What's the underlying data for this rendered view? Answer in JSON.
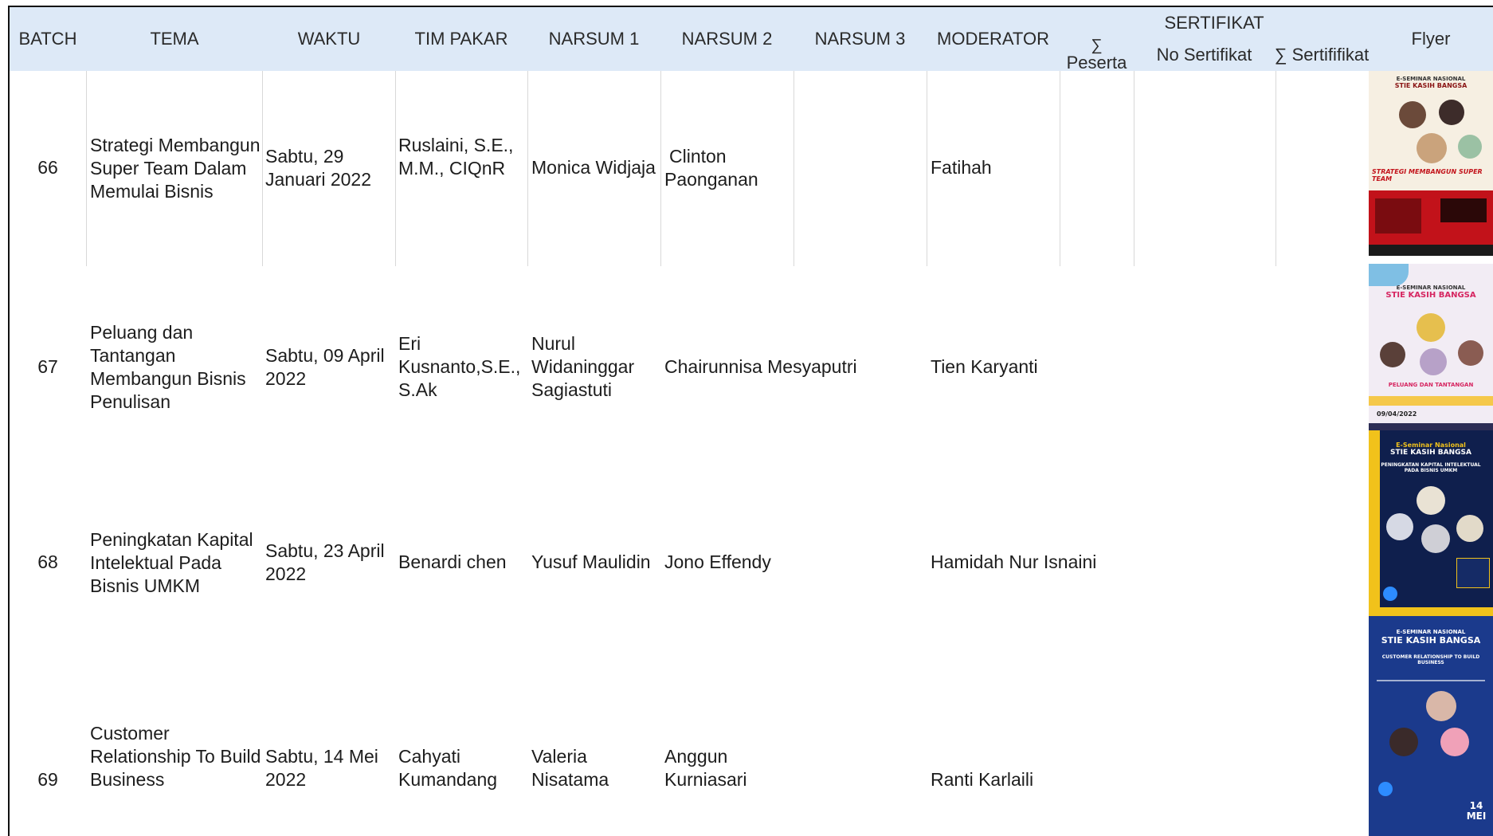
{
  "headers": {
    "batch": "BATCH",
    "tema": "TEMA",
    "waktu": "WAKTU",
    "tim_pakar": "TIM PAKAR",
    "narsum1": "NARSUM 1",
    "narsum2": "NARSUM 2",
    "narsum3": "NARSUM 3",
    "moderator": "MODERATOR",
    "peserta_symbol": "∑",
    "peserta": "Peserta",
    "sertifikat": "SERTIFIKAT",
    "no_sertifikat": "No Sertifikat",
    "sum_sertifikat": "∑ Sertififikat",
    "flyer": "Flyer"
  },
  "rows": [
    {
      "batch": "66",
      "tema": [
        "Strategi Membangun",
        "Super Team Dalam",
        "Memulai Bisnis"
      ],
      "waktu": [
        "Sabtu, 29",
        "Januari 2022"
      ],
      "tim_pakar": [
        "Ruslaini, S.E.,",
        "M.M., CIQnR"
      ],
      "narsum1": [
        "Monica Widjaja"
      ],
      "narsum2": [
        "Clinton",
        "Paonganan"
      ],
      "narsum3": [],
      "moderator": [
        "Fatihah"
      ],
      "flyer": {
        "top": "E-SEMINAR NASIONAL",
        "title": "STIE KASIH BANGSA",
        "tag": "STRATEGI MEMBANGUN SUPER TEAM",
        "bg": "#f6efe2",
        "band": "#c2121a"
      }
    },
    {
      "batch": "67",
      "tema": [
        "Peluang dan",
        "Tantangan",
        "Membangun Bisnis",
        "Penulisan"
      ],
      "waktu": [
        "Sabtu, 09 April",
        "2022"
      ],
      "tim_pakar": [
        "Eri",
        "Kusnanto,S.E.,",
        "S.Ak"
      ],
      "narsum1": [
        "Nurul",
        "Widaninggar",
        "Sagiastuti"
      ],
      "narsum2": [
        "Chairunnisa Mesyaputri"
      ],
      "narsum3": [],
      "moderator": [
        "Tien Karyanti"
      ],
      "flyer": {
        "top": "E-SEMINAR NASIONAL",
        "title": "STIE KASIH BANGSA",
        "tag": "PELUANG DAN TANTANGAN",
        "date": "09/04/2022",
        "bg": "#f2ecf4",
        "band": "#d62560"
      }
    },
    {
      "batch": "68",
      "tema": [
        "Peningkatan Kapital",
        "Intelektual Pada",
        "Bisnis UMKM"
      ],
      "waktu": [
        "Sabtu, 23 April",
        "2022"
      ],
      "tim_pakar": [
        "Benardi chen"
      ],
      "narsum1": [
        "Yusuf Maulidin"
      ],
      "narsum2": [
        "Jono Effendy"
      ],
      "narsum3": [],
      "moderator": [
        "Hamidah Nur Isnaini"
      ],
      "flyer": {
        "top": "E-Seminar Nasional",
        "title": "STIE KASIH BANGSA",
        "tag": "PENINGKATAN KAPITAL INTELEKTUAL PADA BISNIS UMKM",
        "bg": "#0f1f4d",
        "band": "#f1c21b"
      }
    },
    {
      "batch": "69",
      "tema": [
        "Customer",
        "Relationship To Build",
        "Business"
      ],
      "waktu": [
        "Sabtu, 14 Mei",
        "2022"
      ],
      "tim_pakar": [
        "Cahyati",
        "Kumandang"
      ],
      "narsum1": [
        "Valeria",
        "Nisatama"
      ],
      "narsum2": [
        "Anggun",
        "Kurniasari"
      ],
      "narsum3": [],
      "moderator": [
        "Ranti Karlaili"
      ],
      "flyer": {
        "top": "E-SEMINAR NASIONAL",
        "title": "STIE KASIH BANGSA",
        "tag": "CUSTOMER RELATIONSHIP TO BUILD BUSINESS",
        "date": "14 MEI",
        "bg": "#1b3a8c",
        "band": "#ffffff"
      }
    }
  ]
}
